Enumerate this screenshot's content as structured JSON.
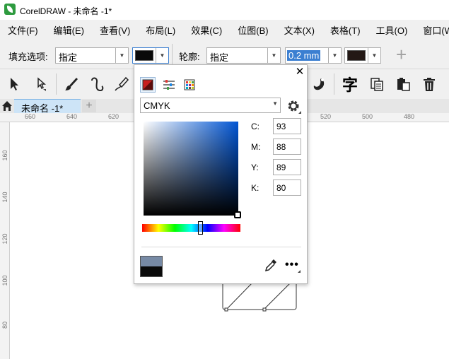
{
  "window": {
    "title": "CorelDRAW - 未命名 -1*"
  },
  "menu": [
    "文件(F)",
    "编辑(E)",
    "查看(V)",
    "布局(L)",
    "效果(C)",
    "位图(B)",
    "文本(X)",
    "表格(T)",
    "工具(O)",
    "窗口(W)"
  ],
  "propbar": {
    "fill_label": "填充选项:",
    "fill_value": "指定",
    "fill_color": "#0a0a0a",
    "outline_label": "轮廓:",
    "outline_value": "指定",
    "outline_width": "0.2 mm",
    "outline_color": "#231815"
  },
  "document_tab": {
    "label": "未命名 -1*"
  },
  "ruler": {
    "h_labels": [
      "660",
      "640",
      "620",
      "520",
      "500",
      "480"
    ],
    "v_labels": [
      "160",
      "140",
      "120",
      "100",
      "80"
    ]
  },
  "color_popup": {
    "model": "CMYK",
    "channels": [
      {
        "label": "C:",
        "value": "93"
      },
      {
        "label": "M:",
        "value": "88"
      },
      {
        "label": "Y:",
        "value": "89"
      },
      {
        "label": "K:",
        "value": "80"
      }
    ],
    "old_color": "#778aa5",
    "new_color": "#0a0a0a",
    "more_label": "•••"
  }
}
